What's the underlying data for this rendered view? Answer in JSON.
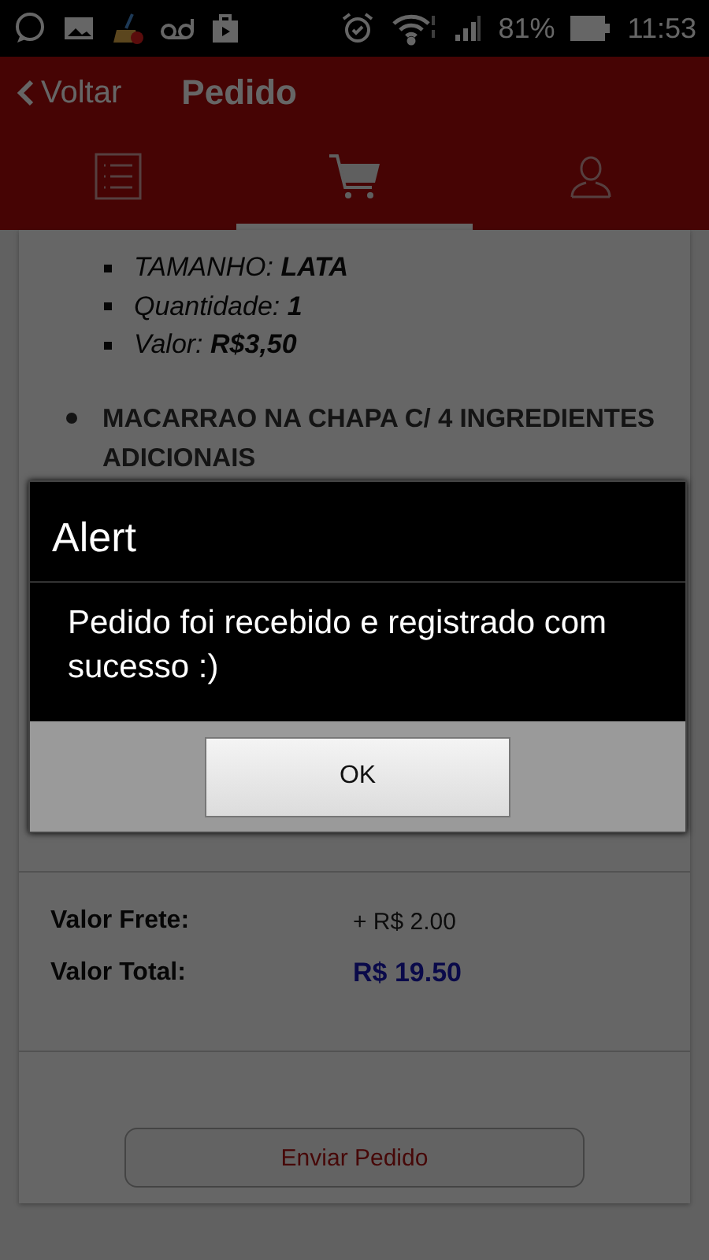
{
  "status_bar": {
    "battery_text": "81%",
    "time": "11:53"
  },
  "header": {
    "back": "Voltar",
    "title": "Pedido"
  },
  "tabs": [
    {
      "kind": "list",
      "selected": false
    },
    {
      "kind": "cart",
      "selected": true
    },
    {
      "kind": "profile",
      "selected": false
    }
  ],
  "order": {
    "details": [
      "TAMANHO: **LATA**",
      "Quantidade: **1**",
      "Valor: **R$3,50**"
    ],
    "item": "MACARRAO NA CHAPA C/ 4 INGREDIENTES ADICIONAIS"
  },
  "totals": [
    {
      "label": "Valor Frete:",
      "value": "+ R$ 2.00",
      "kind": "normal"
    },
    {
      "label": "Valor Total:",
      "value": "R$ 19.50",
      "kind": "total"
    }
  ],
  "send_button": "Enviar Pedido",
  "dialog": {
    "title": "Alert",
    "message": "Pedido foi recebido e registrado com sucesso :)",
    "button": "OK"
  }
}
